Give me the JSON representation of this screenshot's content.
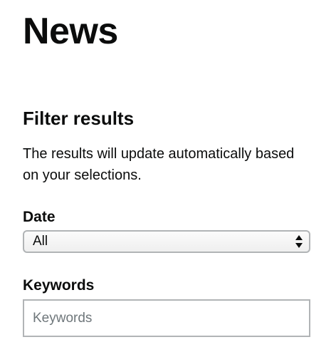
{
  "page": {
    "title": "News"
  },
  "filters": {
    "heading": "Filter results",
    "hint": "The results will update automatically based on your selections.",
    "date": {
      "label": "Date",
      "selected": "All",
      "options": [
        "All"
      ]
    },
    "keywords": {
      "label": "Keywords",
      "value": "",
      "placeholder": "Keywords"
    }
  },
  "colors": {
    "text": "#0b0c0c",
    "border": "#b1b4b6",
    "placeholder": "#6f777b"
  }
}
